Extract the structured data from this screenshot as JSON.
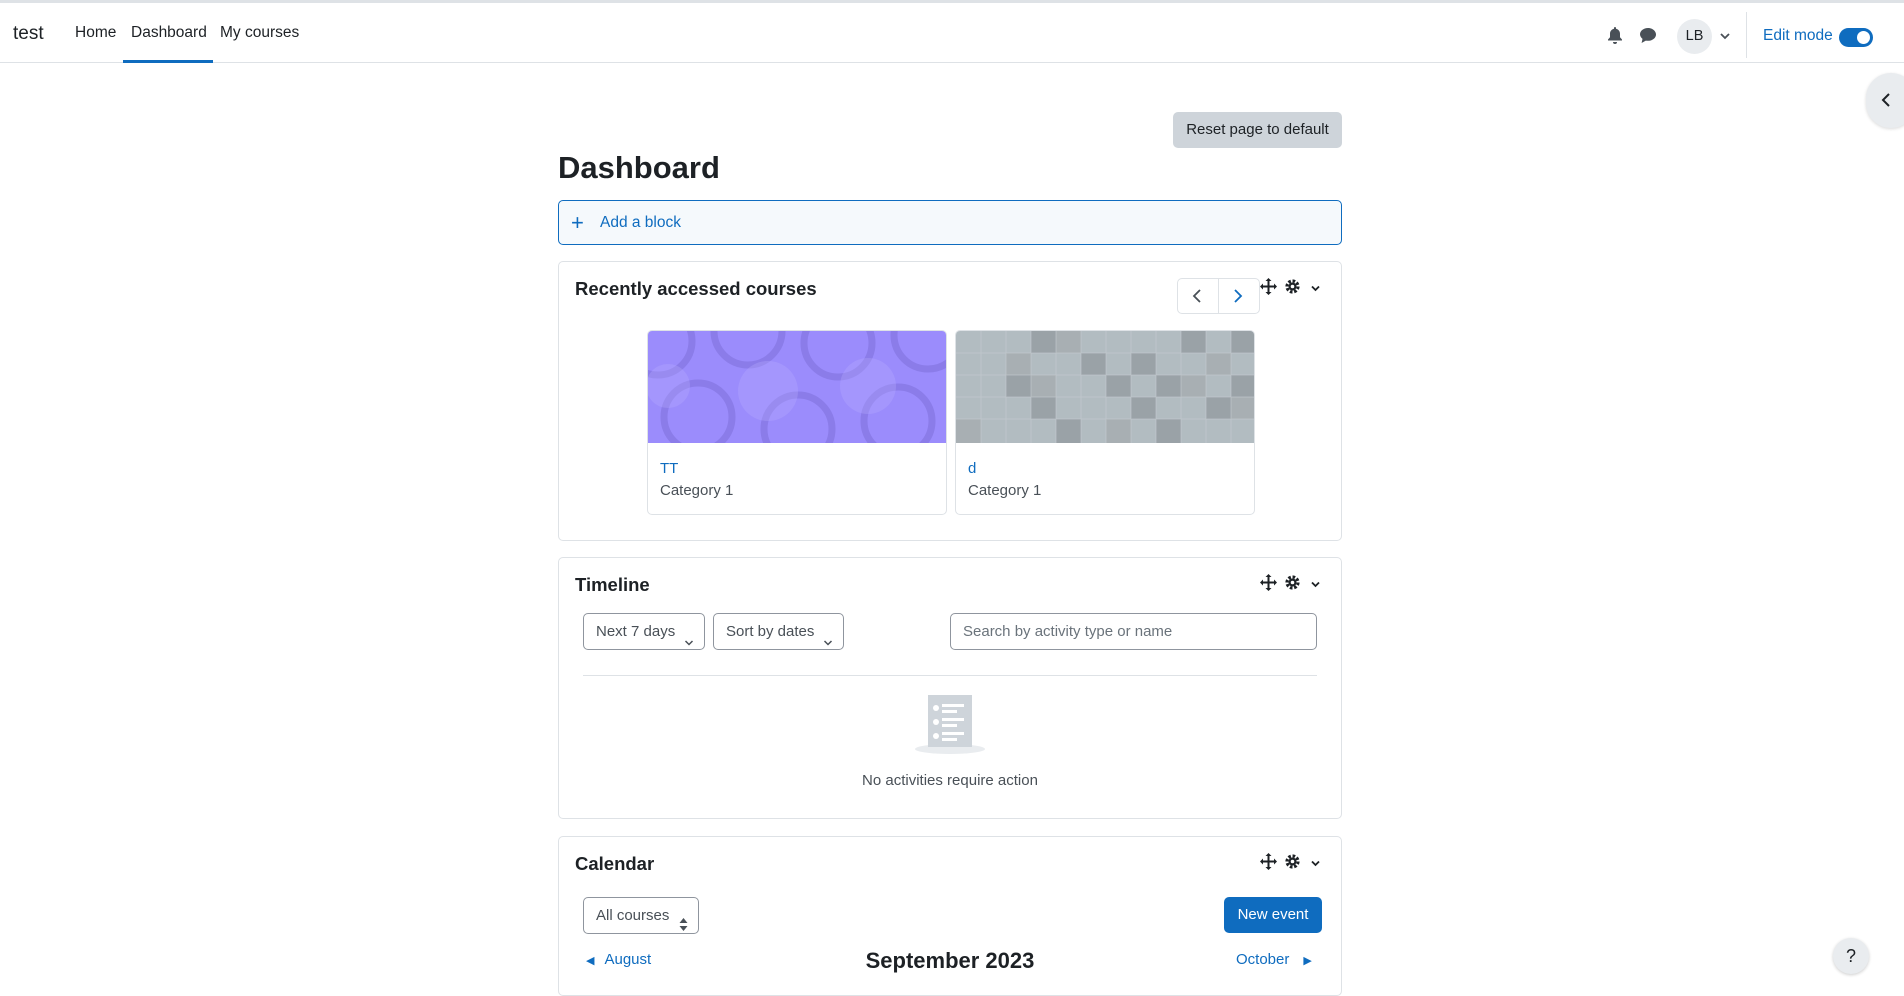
{
  "navbar": {
    "brand": "test",
    "links": [
      "Home",
      "Dashboard",
      "My courses"
    ],
    "active_link": "Dashboard",
    "avatar_initials": "LB",
    "edit_mode_label": "Edit mode",
    "edit_mode_on": true
  },
  "page": {
    "reset_label": "Reset page to default",
    "title": "Dashboard",
    "add_block_label": "Add a block"
  },
  "recent_courses": {
    "title": "Recently accessed courses",
    "courses": [
      {
        "name": "ТТ",
        "category": "Category 1",
        "pattern": "circles",
        "color": "#9b8cfc"
      },
      {
        "name": "d",
        "category": "Category 1",
        "pattern": "squares",
        "color": "#b2bcc1"
      }
    ]
  },
  "timeline": {
    "title": "Timeline",
    "filter_label": "Next 7 days",
    "sort_label": "Sort by dates",
    "search_placeholder": "Search by activity type or name",
    "empty_text": "No activities require action"
  },
  "calendar": {
    "title": "Calendar",
    "course_filter": "All courses",
    "new_event_label": "New event",
    "prev_month": "August",
    "current_month": "September 2023",
    "next_month": "October"
  },
  "help_label": "?",
  "colors": {
    "primary": "#0f6cbf",
    "text": "#1d2125",
    "muted": "#495057",
    "border": "#dee2e6"
  }
}
